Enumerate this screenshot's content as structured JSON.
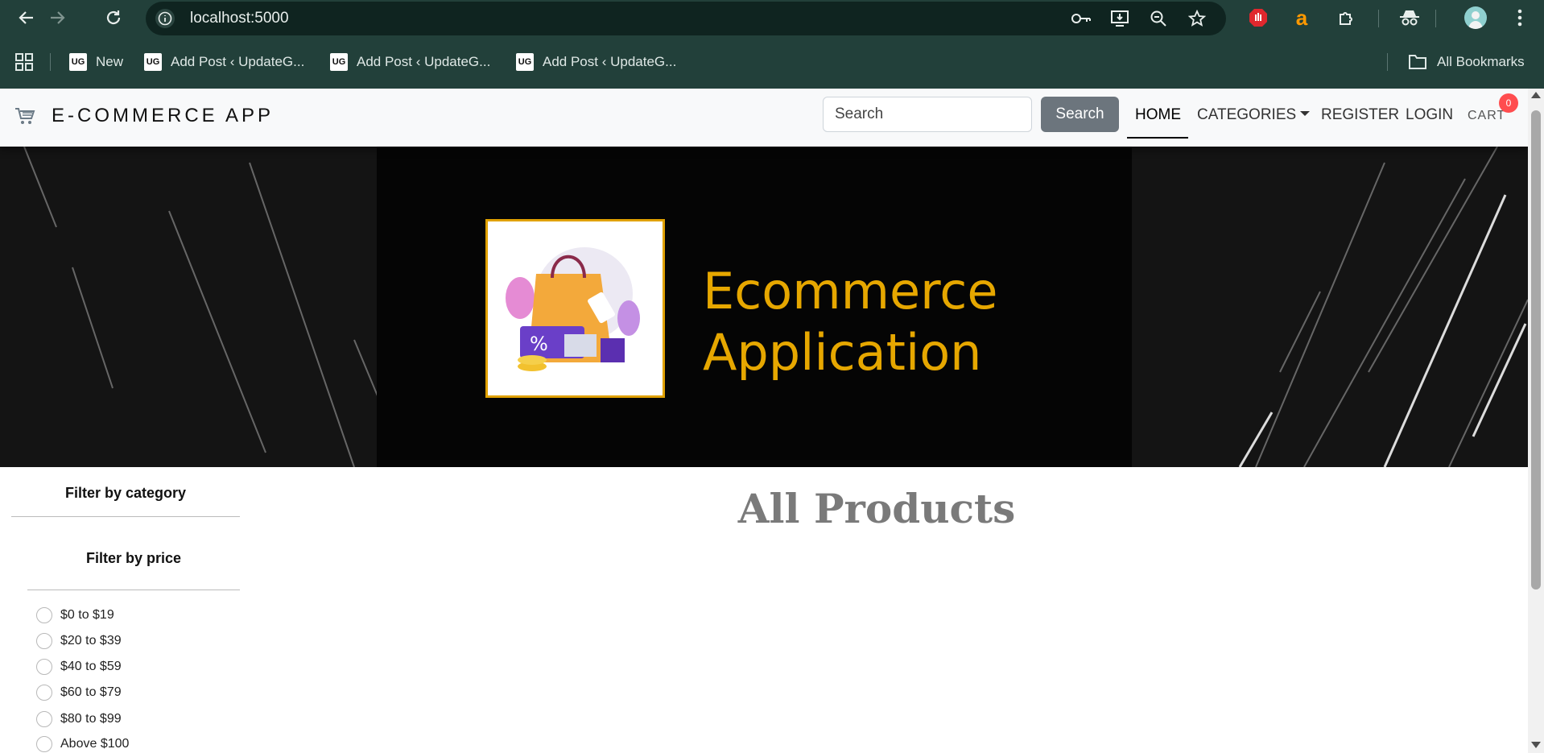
{
  "browser": {
    "url": "localhost:5000",
    "bookmarks": [
      {
        "label": "New",
        "icon": "UG"
      },
      {
        "label": "Add Post ‹ UpdateG...",
        "icon": "UG"
      },
      {
        "label": "Add Post ‹ UpdateG...",
        "icon": "UG"
      },
      {
        "label": "Add Post ‹ UpdateG...",
        "icon": "UG"
      }
    ],
    "all_bookmarks": "All Bookmarks",
    "icons": [
      "back-icon",
      "forward-icon",
      "reload-icon",
      "site-info-icon",
      "key-icon",
      "install-icon",
      "zoom-icon",
      "star-icon",
      "adblock-icon",
      "amazon-icon",
      "extensions-icon",
      "incognito-icon",
      "avatar-icon",
      "menu-icon",
      "apps-icon",
      "folder-icon"
    ]
  },
  "navbar": {
    "brand": "E-COMMERCE APP",
    "search_placeholder": "Search",
    "search_button": "Search",
    "links": {
      "home": "HOME",
      "categories": "CATEGORIES",
      "register": "REGISTER",
      "login": "LOGIN",
      "cart": "CART"
    },
    "cart_count": "0"
  },
  "hero": {
    "title_line1": "Ecommerce",
    "title_line2": "Application"
  },
  "sidebar": {
    "filter_category": "Filter by category",
    "filter_price": "Filter by price",
    "price_options": [
      "$0 to $19",
      "$20 to $39",
      "$40 to $59",
      "$60 to $79",
      "$80 to $99",
      "Above $100"
    ]
  },
  "main": {
    "heading": "All Products"
  },
  "colors": {
    "chrome_bg": "#22403a",
    "omnibox_bg": "#0f2420",
    "hero_text": "#e6a700",
    "badge": "#ff4d4f",
    "search_btn": "#6c757d"
  }
}
